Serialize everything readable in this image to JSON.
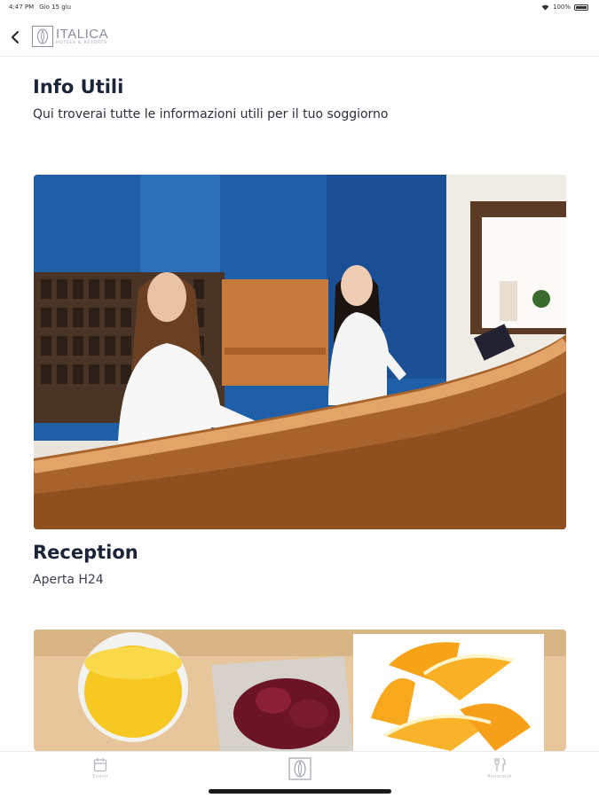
{
  "status_bar": {
    "time": "4:47 PM",
    "date": "Gio 15 giu",
    "battery": "100%"
  },
  "header": {
    "brand_name": "ITALICA",
    "brand_tagline": "HOTELS & RESORTS"
  },
  "page": {
    "title": "Info Utili",
    "subtitle": "Qui troverai tutte le informazioni utili per il tuo soggiorno"
  },
  "cards": [
    {
      "title": "Reception",
      "subtitle": "Aperta H24"
    },
    {
      "title": "",
      "subtitle": ""
    }
  ],
  "tab_bar": {
    "items": [
      {
        "label": "Eventi",
        "icon": "calendar-icon"
      },
      {
        "label": "",
        "icon": "hotel-logo-icon"
      },
      {
        "label": "Ristoranti",
        "icon": "fork-knife-icon"
      }
    ]
  },
  "colors": {
    "title_text": "#1c2438",
    "wall_blue": "#1e5fa8",
    "counter_wood": "#b5743a",
    "tab_inactive": "#b6b9c0"
  }
}
